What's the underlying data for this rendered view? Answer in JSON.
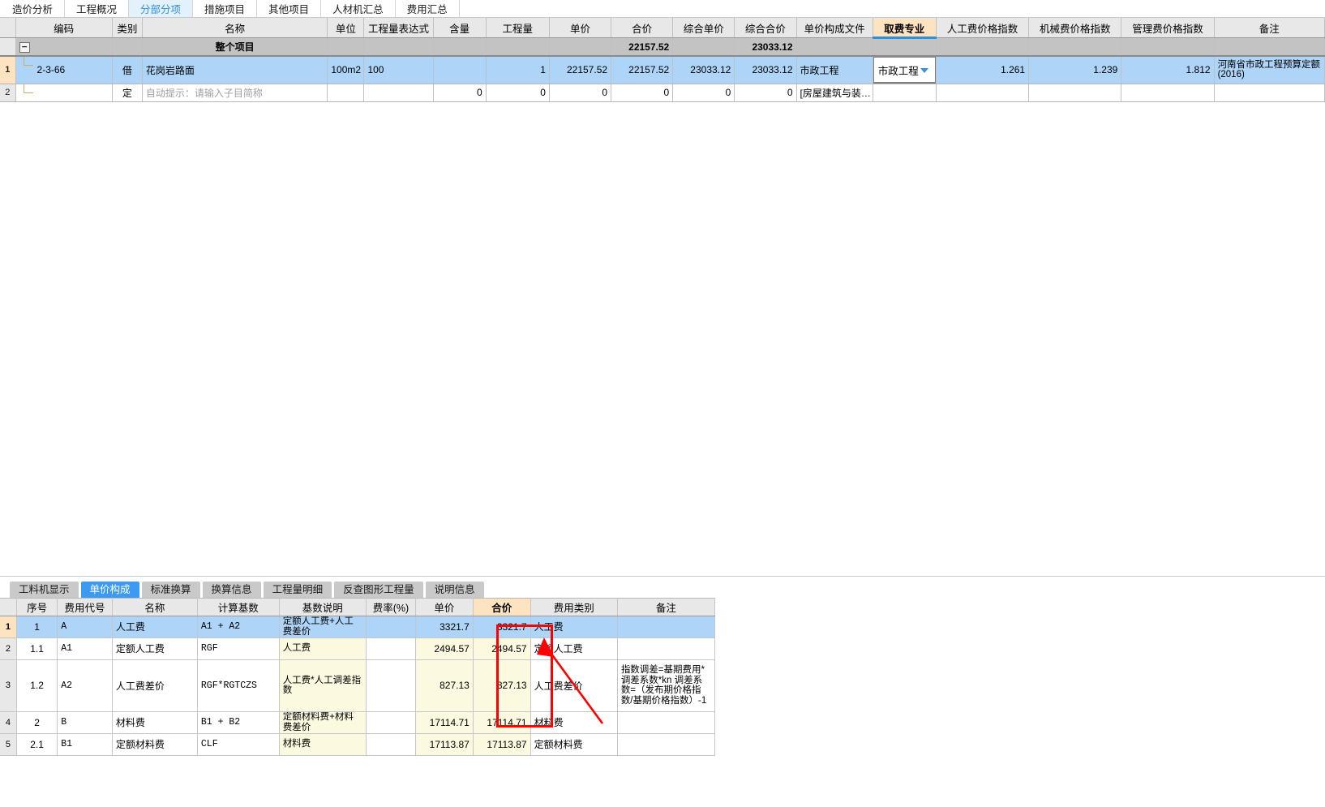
{
  "module_tabs": [
    {
      "label": "造价分析",
      "active": false
    },
    {
      "label": "工程概况",
      "active": false
    },
    {
      "label": "分部分项",
      "active": true
    },
    {
      "label": "措施项目",
      "active": false
    },
    {
      "label": "其他项目",
      "active": false
    },
    {
      "label": "人材机汇总",
      "active": false
    },
    {
      "label": "费用汇总",
      "active": false
    }
  ],
  "main_grid": {
    "columns": [
      {
        "label": "编码"
      },
      {
        "label": "类别"
      },
      {
        "label": "名称"
      },
      {
        "label": "单位"
      },
      {
        "label": "工程量表达式"
      },
      {
        "label": "含量"
      },
      {
        "label": "工程量"
      },
      {
        "label": "单价"
      },
      {
        "label": "合价"
      },
      {
        "label": "综合单价"
      },
      {
        "label": "综合合价"
      },
      {
        "label": "单价构成文件"
      },
      {
        "label": "取费专业",
        "highlighted": true
      },
      {
        "label": "人工费价格指数"
      },
      {
        "label": "机械费价格指数"
      },
      {
        "label": "管理费价格指数"
      },
      {
        "label": "备注"
      }
    ],
    "group_row": {
      "row_header": "",
      "name": "整个项目",
      "he_jia": "22157.52",
      "zong_he_he_jia": "23033.12"
    },
    "rows": [
      {
        "row_header": "1",
        "selected": true,
        "bianma": "2-3-66",
        "leibie": "借",
        "mingcheng": "花岗岩路面",
        "danwei": "100m2",
        "gongchengliang_biaodashi": "100",
        "hanliang": "",
        "gongchengliang": "1",
        "danjia": "22157.52",
        "hejia": "22157.52",
        "zonghe_danjia": "23033.12",
        "zonghe_hejia": "23033.12",
        "danjia_goucheng_wenjian": "市政工程",
        "qufei_zhuanye": "市政工程",
        "qufei_editing": true,
        "rengongfei_zhishu": "1.261",
        "jixiefei_zhishu": "1.239",
        "guanlifei_zhishu": "1.812",
        "beizhu": "河南省市政工程预算定额(2016)"
      },
      {
        "row_header": "2",
        "selected": false,
        "bianma": "",
        "leibie": "定",
        "mingcheng": "自动提示：请输入子目简称",
        "mingcheng_is_placeholder": true,
        "danwei": "",
        "gongchengliang_biaodashi": "",
        "hanliang": "0",
        "gongchengliang": "0",
        "danjia": "0",
        "hejia": "0",
        "zonghe_danjia": "0",
        "zonghe_hejia": "0",
        "danjia_goucheng_wenjian": "[房屋建筑与装…",
        "qufei_zhuanye": "",
        "qufei_editing": false,
        "rengongfei_zhishu": "",
        "jixiefei_zhishu": "",
        "guanlifei_zhishu": "",
        "beizhu": ""
      }
    ]
  },
  "bottom_tabs": [
    {
      "label": "工料机显示",
      "active": false
    },
    {
      "label": "单价构成",
      "active": true
    },
    {
      "label": "标准换算",
      "active": false
    },
    {
      "label": "换算信息",
      "active": false
    },
    {
      "label": "工程量明细",
      "active": false
    },
    {
      "label": "反查图形工程量",
      "active": false
    },
    {
      "label": "说明信息",
      "active": false
    }
  ],
  "bottom_grid": {
    "columns": [
      {
        "label": "序号"
      },
      {
        "label": "费用代号"
      },
      {
        "label": "名称"
      },
      {
        "label": "计算基数"
      },
      {
        "label": "基数说明"
      },
      {
        "label": "费率(%)"
      },
      {
        "label": "单价"
      },
      {
        "label": "合价",
        "highlighted": true
      },
      {
        "label": "费用类别"
      },
      {
        "label": "备注"
      }
    ],
    "rows": [
      {
        "row_header": "1",
        "selected": true,
        "xuhao": "1",
        "feiyong_daihao": "A",
        "mingcheng": "人工费",
        "jisuan_jishu": "A1 + A2",
        "jishu_shuoming": "定额人工费+人工费差价",
        "feilv": "",
        "danjia": "3321.7",
        "heji": "3321.7",
        "feiyong_leibie": "人工费",
        "beizhu": ""
      },
      {
        "row_header": "2",
        "selected": false,
        "xuhao": "1.1",
        "feiyong_daihao": "A1",
        "mingcheng": "定额人工费",
        "jisuan_jishu": "RGF",
        "jishu_shuoming": "人工费",
        "feilv": "",
        "danjia": "2494.57",
        "heji": "2494.57",
        "feiyong_leibie": "定额人工费",
        "beizhu": ""
      },
      {
        "row_header": "3",
        "selected": false,
        "xuhao": "1.2",
        "feiyong_daihao": "A2",
        "mingcheng": "人工费差价",
        "jisuan_jishu": "RGF*RGTCZS",
        "jishu_shuoming": "人工费*人工调差指数",
        "feilv": "",
        "danjia": "827.13",
        "heji": "827.13",
        "feiyong_leibie": "人工费差价",
        "beizhu": "指数调差=基期费用*调差系数*kn\n调差系数=（发布期价格指数/基期价格指数）-1"
      },
      {
        "row_header": "4",
        "selected": false,
        "xuhao": "2",
        "feiyong_daihao": "B",
        "mingcheng": "材料费",
        "jisuan_jishu": "B1 + B2",
        "jishu_shuoming": "定额材料费+材料费差价",
        "feilv": "",
        "danjia": "17114.71",
        "heji": "17114.71",
        "feiyong_leibie": "材料费",
        "beizhu": ""
      },
      {
        "row_header": "5",
        "selected": false,
        "xuhao": "2.1",
        "feiyong_daihao": "B1",
        "mingcheng": "定额材料费",
        "jisuan_jishu": "CLF",
        "jishu_shuoming": "材料费",
        "feilv": "",
        "danjia": "17113.87",
        "heji": "17113.87",
        "feiyong_leibie": "定额材料费",
        "beizhu": ""
      }
    ]
  },
  "annotations": {
    "highlight_label": "合价-highlight",
    "color": "#ff0000"
  }
}
